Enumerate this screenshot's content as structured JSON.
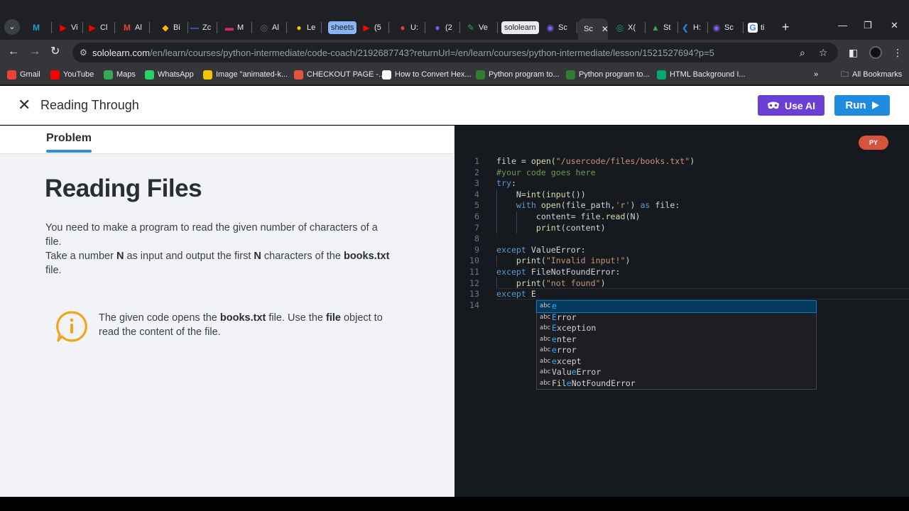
{
  "browser": {
    "tabs": [
      {
        "label": "",
        "color": "#1f9bd1",
        "glyph": "M"
      },
      {
        "label": "Vi",
        "color": "#ff0000",
        "glyph": "▶"
      },
      {
        "label": "Cl",
        "color": "#ff0000",
        "glyph": "▶"
      },
      {
        "label": "Al",
        "color": "#ea4335",
        "glyph": "M"
      },
      {
        "label": "Bi",
        "color": "#f0b90b",
        "glyph": "◆"
      },
      {
        "label": "Zc",
        "color": "#4a6cf7",
        "glyph": "—"
      },
      {
        "label": "M",
        "color": "#e0245e",
        "glyph": "▬"
      },
      {
        "label": "Al",
        "color": "#5f6368",
        "glyph": "◎"
      },
      {
        "label": "Le",
        "color": "#f5c400",
        "glyph": "●"
      },
      {
        "label": "(5",
        "color": "#ff0000",
        "glyph": "▶"
      },
      {
        "label": "U:",
        "color": "#e53935",
        "glyph": "●"
      },
      {
        "label": "(2",
        "color": "#7a5cfa",
        "glyph": "●"
      },
      {
        "label": "Ve",
        "color": "#34a853",
        "glyph": "✎"
      },
      {
        "label": "Sc",
        "color": "#8a5cf5",
        "glyph": "◉"
      },
      {
        "label": "Sc",
        "color": "#8a5cf5",
        "glyph": "◉"
      },
      {
        "label": "X(",
        "color": "#10a37f",
        "glyph": "◎"
      },
      {
        "label": "St",
        "color": "#34a853",
        "glyph": "▲"
      },
      {
        "label": "H:",
        "color": "#1e88e5",
        "glyph": "❮"
      },
      {
        "label": "Sc",
        "color": "#8a5cf5",
        "glyph": "◉"
      },
      {
        "label": "ti",
        "color": "#ffffff",
        "glyph": "G"
      }
    ],
    "chip_sheets": "sheets",
    "chip_sololearn": "sololearn",
    "active_tab_label": "Sc",
    "url_host": "sololearn.com",
    "url_path": "/en/learn/courses/python-intermediate/code-coach/2192687743?returnUrl=/en/learn/courses/python-intermediate/lesson/1521527694?p=5",
    "bookmarks": [
      {
        "label": "Gmail",
        "color": "#ea4335"
      },
      {
        "label": "YouTube",
        "color": "#ff0000"
      },
      {
        "label": "Maps",
        "color": "#34a853"
      },
      {
        "label": "WhatsApp",
        "color": "#25d366"
      },
      {
        "label": "Image \"animated-k...",
        "color": "#f5c400"
      },
      {
        "label": "CHECKOUT PAGE -...",
        "color": "#e5533d"
      },
      {
        "label": "How to Convert Hex...",
        "color": "#ffffff"
      },
      {
        "label": "Python program to...",
        "color": "#2e7d32"
      },
      {
        "label": "Python program to...",
        "color": "#2e7d32"
      },
      {
        "label": "HTML Background I...",
        "color": "#04aa6d"
      }
    ],
    "all_bookmarks": "All Bookmarks"
  },
  "header": {
    "title": "Reading Through",
    "use_ai_label": "Use AI",
    "run_label": "Run"
  },
  "problem": {
    "tab_label": "Problem",
    "heading": "Reading Files",
    "para1": "You need to make a program to read the given number of characters of a file.",
    "para2_a": "Take a number ",
    "para2_n1": "N",
    "para2_b": " as input and output the first ",
    "para2_n2": "N",
    "para2_c": " characters of the ",
    "para2_file": "books.txt",
    "para2_d": " file.",
    "info_a": "The given code opens the ",
    "info_file": "books.txt",
    "info_b": " file. Use the ",
    "info_obj": "file",
    "info_c": " object to read the content of the file."
  },
  "editor": {
    "lang_badge": "PY",
    "lines": [
      "file = open(\"/usercode/files/books.txt\")",
      "#your code goes here",
      "try:",
      "    N=int(input())",
      "    with open(file_path,'r') as file:",
      "        content= file.read(N)",
      "        print(content)",
      "",
      "except ValueError:",
      "    print(\"Invalid input!\")",
      "except FileNotFoundError:",
      "    print(\"not found\")",
      "except E",
      ""
    ],
    "suggestions": [
      {
        "kind": "abc",
        "label": "e"
      },
      {
        "kind": "abc",
        "label": "Error"
      },
      {
        "kind": "abc",
        "label": "Exception"
      },
      {
        "kind": "abc",
        "label": "enter"
      },
      {
        "kind": "abc",
        "label": "error"
      },
      {
        "kind": "abc",
        "label": "except"
      },
      {
        "kind": "abc",
        "label": "ValueError"
      },
      {
        "kind": "abc",
        "label": "FileNotFoundError"
      }
    ]
  },
  "colors": {
    "use_ai": "#6b3fd4",
    "run": "#1f8be0",
    "accent": "#2f8fe0",
    "py_badge": "#d5533f",
    "info_icon": "#f2a51a"
  }
}
